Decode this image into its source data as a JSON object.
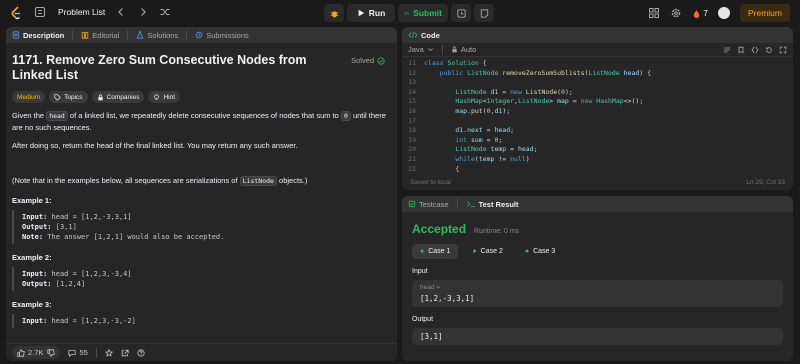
{
  "nav": {
    "problem_list": "Problem List",
    "run": "Run",
    "submit": "Submit",
    "streak": "7",
    "premium": "Premium"
  },
  "left": {
    "tabs": [
      "Description",
      "Editorial",
      "Solutions",
      "Submissions"
    ],
    "title": "1171. Remove Zero Sum Consecutive Nodes from Linked List",
    "solved": "Solved",
    "difficulty": "Medium",
    "chips": [
      "Topics",
      "Companies",
      "Hint"
    ],
    "para1_a": "Given the ",
    "para1_code": "head",
    "para1_b": " of a linked list, we repeatedly delete consecutive sequences of nodes that sum to ",
    "para1_zero": "0",
    "para1_c": " until there are no such sequences.",
    "para2": "After doing so, return the head of the final linked list.  You may return any such answer.",
    "para3_a": "(Note that in the examples below, all sequences are serializations of ",
    "para3_code": "ListNode",
    "para3_b": " objects.)",
    "examples": [
      {
        "h": "Example 1:",
        "input": "head = [1,2,-3,3,1]",
        "output": "[3,1]",
        "note": "The answer [1,2,1] would also be accepted."
      },
      {
        "h": "Example 2:",
        "input": "head = [1,2,3,-3,4]",
        "output": "[1,2,4]"
      },
      {
        "h": "Example 3:",
        "input": "head = [1,2,3,-3,-2]"
      }
    ],
    "label_input": "Input:",
    "label_output": "Output:",
    "label_note": "Note:",
    "likes": "2.7K",
    "comments": "55"
  },
  "code": {
    "tab": "Code",
    "language": "Java",
    "auto": "Auto",
    "saved": "Saved to local",
    "position": "Ln 29, Col 33",
    "lines": [
      {
        "n": "11",
        "html": "<span class=\"kw\">class</span> <span class=\"ty\">Solution</span> {"
      },
      {
        "n": "12",
        "html": "    <span class=\"kw\">public</span> <span class=\"ty\">ListNode</span> <span class=\"fn\">removeZeroSumSublists</span>(<span class=\"ty\">ListNode</span> <span class=\"vr\">head</span>) {"
      },
      {
        "n": "13",
        "html": ""
      },
      {
        "n": "14",
        "html": "        <span class=\"ty\">ListNode</span> <span class=\"vr\">d1</span> = <span class=\"kw\">new</span> <span class=\"fn\">ListNode</span>(<span class=\"nm\">0</span>);"
      },
      {
        "n": "15",
        "html": "        <span class=\"ty\">HashMap</span>&lt;<span class=\"ty\">Integer</span>,<span class=\"ty\">ListNode</span>&gt; <span class=\"vr\">map</span> = <span class=\"kw\">new</span> <span class=\"ty\">HashMap</span>&lt;&gt;();"
      },
      {
        "n": "16",
        "html": "        <span class=\"vr\">map</span>.<span class=\"fn\">put</span>(<span class=\"nm\">0</span>,<span class=\"vr\">d1</span>);"
      },
      {
        "n": "17",
        "html": ""
      },
      {
        "n": "18",
        "html": "        <span class=\"vr\">d1</span>.<span class=\"vr\">next</span> = <span class=\"vr\">head</span>;"
      },
      {
        "n": "19",
        "html": "        <span class=\"kw\">int</span> <span class=\"vr\">sum</span> = <span class=\"nm\">0</span>;"
      },
      {
        "n": "20",
        "html": "        <span class=\"ty\">ListNode</span> <span class=\"vr\">temp</span> = <span class=\"vr\">head</span>;"
      },
      {
        "n": "21",
        "html": "        <span class=\"kw\">while</span>(<span class=\"vr\">temp</span> != <span class=\"kw\">null</span>)"
      },
      {
        "n": "22",
        "html": "        {"
      }
    ]
  },
  "test": {
    "tabs": [
      "Testcase",
      "Test Result"
    ],
    "status": "Accepted",
    "runtime": "Runtime: 0 ms",
    "cases": [
      "Case 1",
      "Case 2",
      "Case 3"
    ],
    "input_label": "Input",
    "input_key": "head =",
    "input_value": "[1,2,-3,3,1]",
    "output_label": "Output",
    "output_value": "[3,1]"
  }
}
